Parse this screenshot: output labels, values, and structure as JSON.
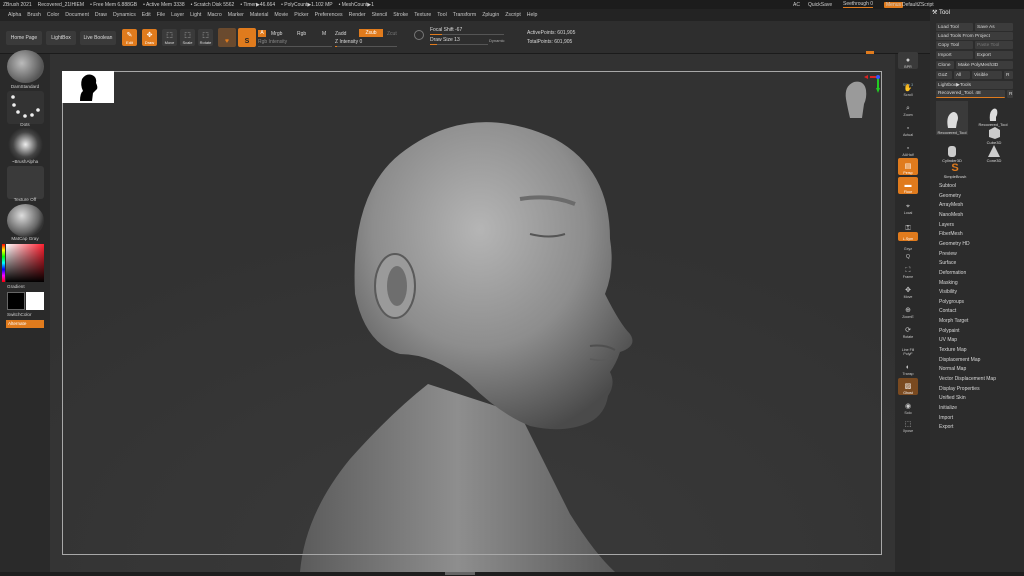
{
  "titlebar": {
    "app": "ZBrush 2021",
    "file": "Recovered_21IHIEM",
    "free_mem": "• Free Mem 6.888GB",
    "active_mem": "• Active Mem 3338",
    "scratch": "• Scratch Disk 5562",
    "timer": "• Timer▶46.664",
    "polycount": "• PolyCount▶1.102 MP",
    "meshcount": "• MeshCount▶1",
    "ac": "AC",
    "quicksave": "QuickSave",
    "seethrough": "Seethrough",
    "seethrough_val": "0",
    "menus": "Menus",
    "script": "DefaultZScript"
  },
  "menubar": [
    "Alpha",
    "Brush",
    "Color",
    "Document",
    "Draw",
    "Dynamics",
    "Edit",
    "File",
    "Layer",
    "Light",
    "Macro",
    "Marker",
    "Material",
    "Movie",
    "Picker",
    "Preferences",
    "Render",
    "Stencil",
    "Stroke",
    "Texture",
    "Tool",
    "Transform",
    "Zplugin",
    "Zscript",
    "Help"
  ],
  "shelf": {
    "home": "Home Page",
    "lightbox": "LightBox",
    "live_boolean": "Live Boolean",
    "tools": [
      "Edit",
      "Draw",
      "Move",
      "Scale",
      "Rotate"
    ],
    "a_label": "A",
    "mrgb": "Mrgb",
    "rgb": "Rgb",
    "m": "M",
    "zadd": "Zadd",
    "zsub": "Zsub",
    "zcut": "Zcut",
    "rgb_intensity": "Rgb Intensity",
    "z_intensity": "Z Intensity 0",
    "focal_shift": "Focal Shift -67",
    "draw_size": "Draw Size 13",
    "dynamic": "Dynamic",
    "active_points": "ActivePoints: 601,905",
    "total_points": "TotalPoints: 601,905"
  },
  "leftpanel": {
    "brush": "DamStandard",
    "stroke": "Dots",
    "alpha": "~BrushAlpha",
    "texture": "Texture Off",
    "material": "MatCap Gray",
    "gradient": "Gradient",
    "switch": "SwitchColor",
    "alternate": "Alternate"
  },
  "rightshelf": [
    "BPR",
    "SPix 3",
    "Scroll",
    "Zoom",
    "Actual",
    "AAHalf",
    "Persp",
    "Floor",
    "Local",
    "",
    "L.Sym",
    "Gxyz",
    "",
    "Frame",
    "Move",
    "ZoomE",
    "Rotate",
    "Line Fill PolyF",
    "Transp",
    "Ghost",
    "Solo",
    "Xpose"
  ],
  "toolpanel": {
    "title": "Tool",
    "load_tool": "Load Tool",
    "save_as": "Save As",
    "load_project": "Load Tools From Project",
    "copy_tool": "Copy Tool",
    "paste_tool": "Paste Tool",
    "import": "Import",
    "export": "Export",
    "clone": "Clone",
    "make_polymesh": "Make PolyMesh3D",
    "goz": "GoZ",
    "all": "All",
    "visible": "Visible",
    "r": "R",
    "lightbox_tools": "Lightbox▶Tools",
    "recovered_tool": "Recovered_Tool. 48",
    "recovered_val": "R",
    "thumbs": [
      "Recovered_Tool",
      "Recovered_Tool",
      "Cube3D",
      "Cylinder3D",
      "Cone3D",
      "SimpleBrush"
    ],
    "items": [
      "Subtool",
      "Geometry",
      "ArrayMesh",
      "NanoMesh",
      "Layers",
      "FiberMesh",
      "Geometry HD",
      "Preview",
      "Surface",
      "Deformation",
      "Masking",
      "Visibility",
      "Polygroups",
      "Contact",
      "Morph Target",
      "Polypaint",
      "UV Map",
      "Texture Map",
      "Displacement Map",
      "Normal Map",
      "Vector Displacement Map",
      "Display Properties",
      "Unified Skin",
      "Initialize",
      "Import",
      "Export"
    ]
  },
  "colors": {
    "accent": "#e07b1d",
    "canvas": "#323232",
    "panel": "#2a2a2a"
  }
}
